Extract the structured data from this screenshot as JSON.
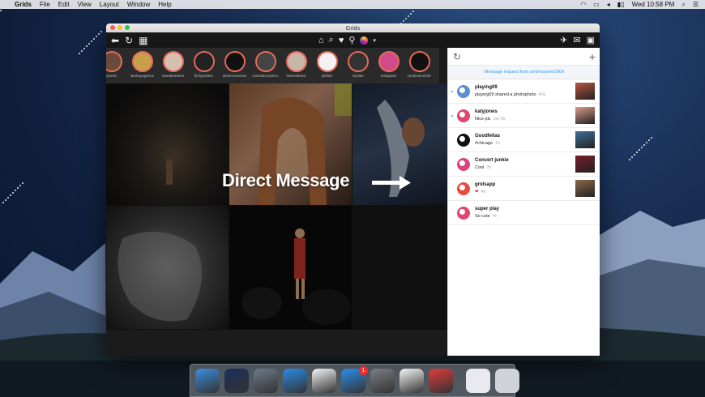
{
  "menubar": {
    "app_name": "Grids",
    "menus": [
      "File",
      "Edit",
      "View",
      "Layout",
      "Window",
      "Help"
    ],
    "clock": "Wed 10:58 PM"
  },
  "window": {
    "title": "Grids"
  },
  "stories": [
    "aryonel...",
    "iamkayagenon",
    "mandirandom",
    "fitchposters",
    "akmicronoman",
    "mandatorytokiro",
    "helmetkaize",
    "joblitsz",
    "rojzlate",
    "instagram",
    "productionhire",
    "thevorkenc"
  ],
  "overlay": {
    "text": "Direct Message"
  },
  "dm": {
    "request_text": "Message request from amirhossein2909",
    "threads": [
      {
        "name": "playing09",
        "message": "playing09 shared a photophoto",
        "time": "40s",
        "unread": true,
        "avatar_color": "#5b8fd1",
        "thumb_color": "#b5563e"
      },
      {
        "name": "katyjones",
        "message": "Nice pic",
        "time": "3m 0s",
        "unread": true,
        "avatar_color": "#e0456f",
        "thumb_color": "#d89a8c"
      },
      {
        "name": "Goodfellas",
        "message": "#chicago",
        "time": "1h",
        "unread": false,
        "avatar_color": "#111111",
        "thumb_color": "#3f6f9a"
      },
      {
        "name": "Concert junkie",
        "message": "Cool",
        "time": "2h",
        "unread": false,
        "avatar_color": "#d94580",
        "thumb_color": "#7a1c2a"
      },
      {
        "name": "gridsapp",
        "message": "❤",
        "time": "4h",
        "unread": false,
        "avatar_color": "#e84c3d",
        "thumb_color": "#8a6a4a"
      },
      {
        "name": "super play",
        "message": "So cute",
        "time": "4h",
        "unread": false,
        "avatar_color": "#e0456f",
        "thumb_color": ""
      }
    ]
  },
  "dock": {
    "apps": [
      {
        "name": "finder",
        "color": "#3b8fe0",
        "badge": ""
      },
      {
        "name": "siri",
        "color": "#1c2e5c",
        "badge": ""
      },
      {
        "name": "launchpad",
        "color": "#6f7a88",
        "badge": ""
      },
      {
        "name": "safari",
        "color": "#2a8be8",
        "badge": ""
      },
      {
        "name": "itunes",
        "color": "#f4f4f4",
        "badge": ""
      },
      {
        "name": "app-store",
        "color": "#2b8fee",
        "badge": "1"
      },
      {
        "name": "system-preferences",
        "color": "#7b7f86",
        "badge": ""
      },
      {
        "name": "photos",
        "color": "#f6f6f6",
        "badge": ""
      },
      {
        "name": "grids",
        "color": "#e23c3c",
        "badge": ""
      }
    ],
    "others": [
      {
        "name": "pdf-document",
        "color": "#e9e9ee"
      },
      {
        "name": "trash",
        "color": "#cfd3d8"
      }
    ]
  }
}
